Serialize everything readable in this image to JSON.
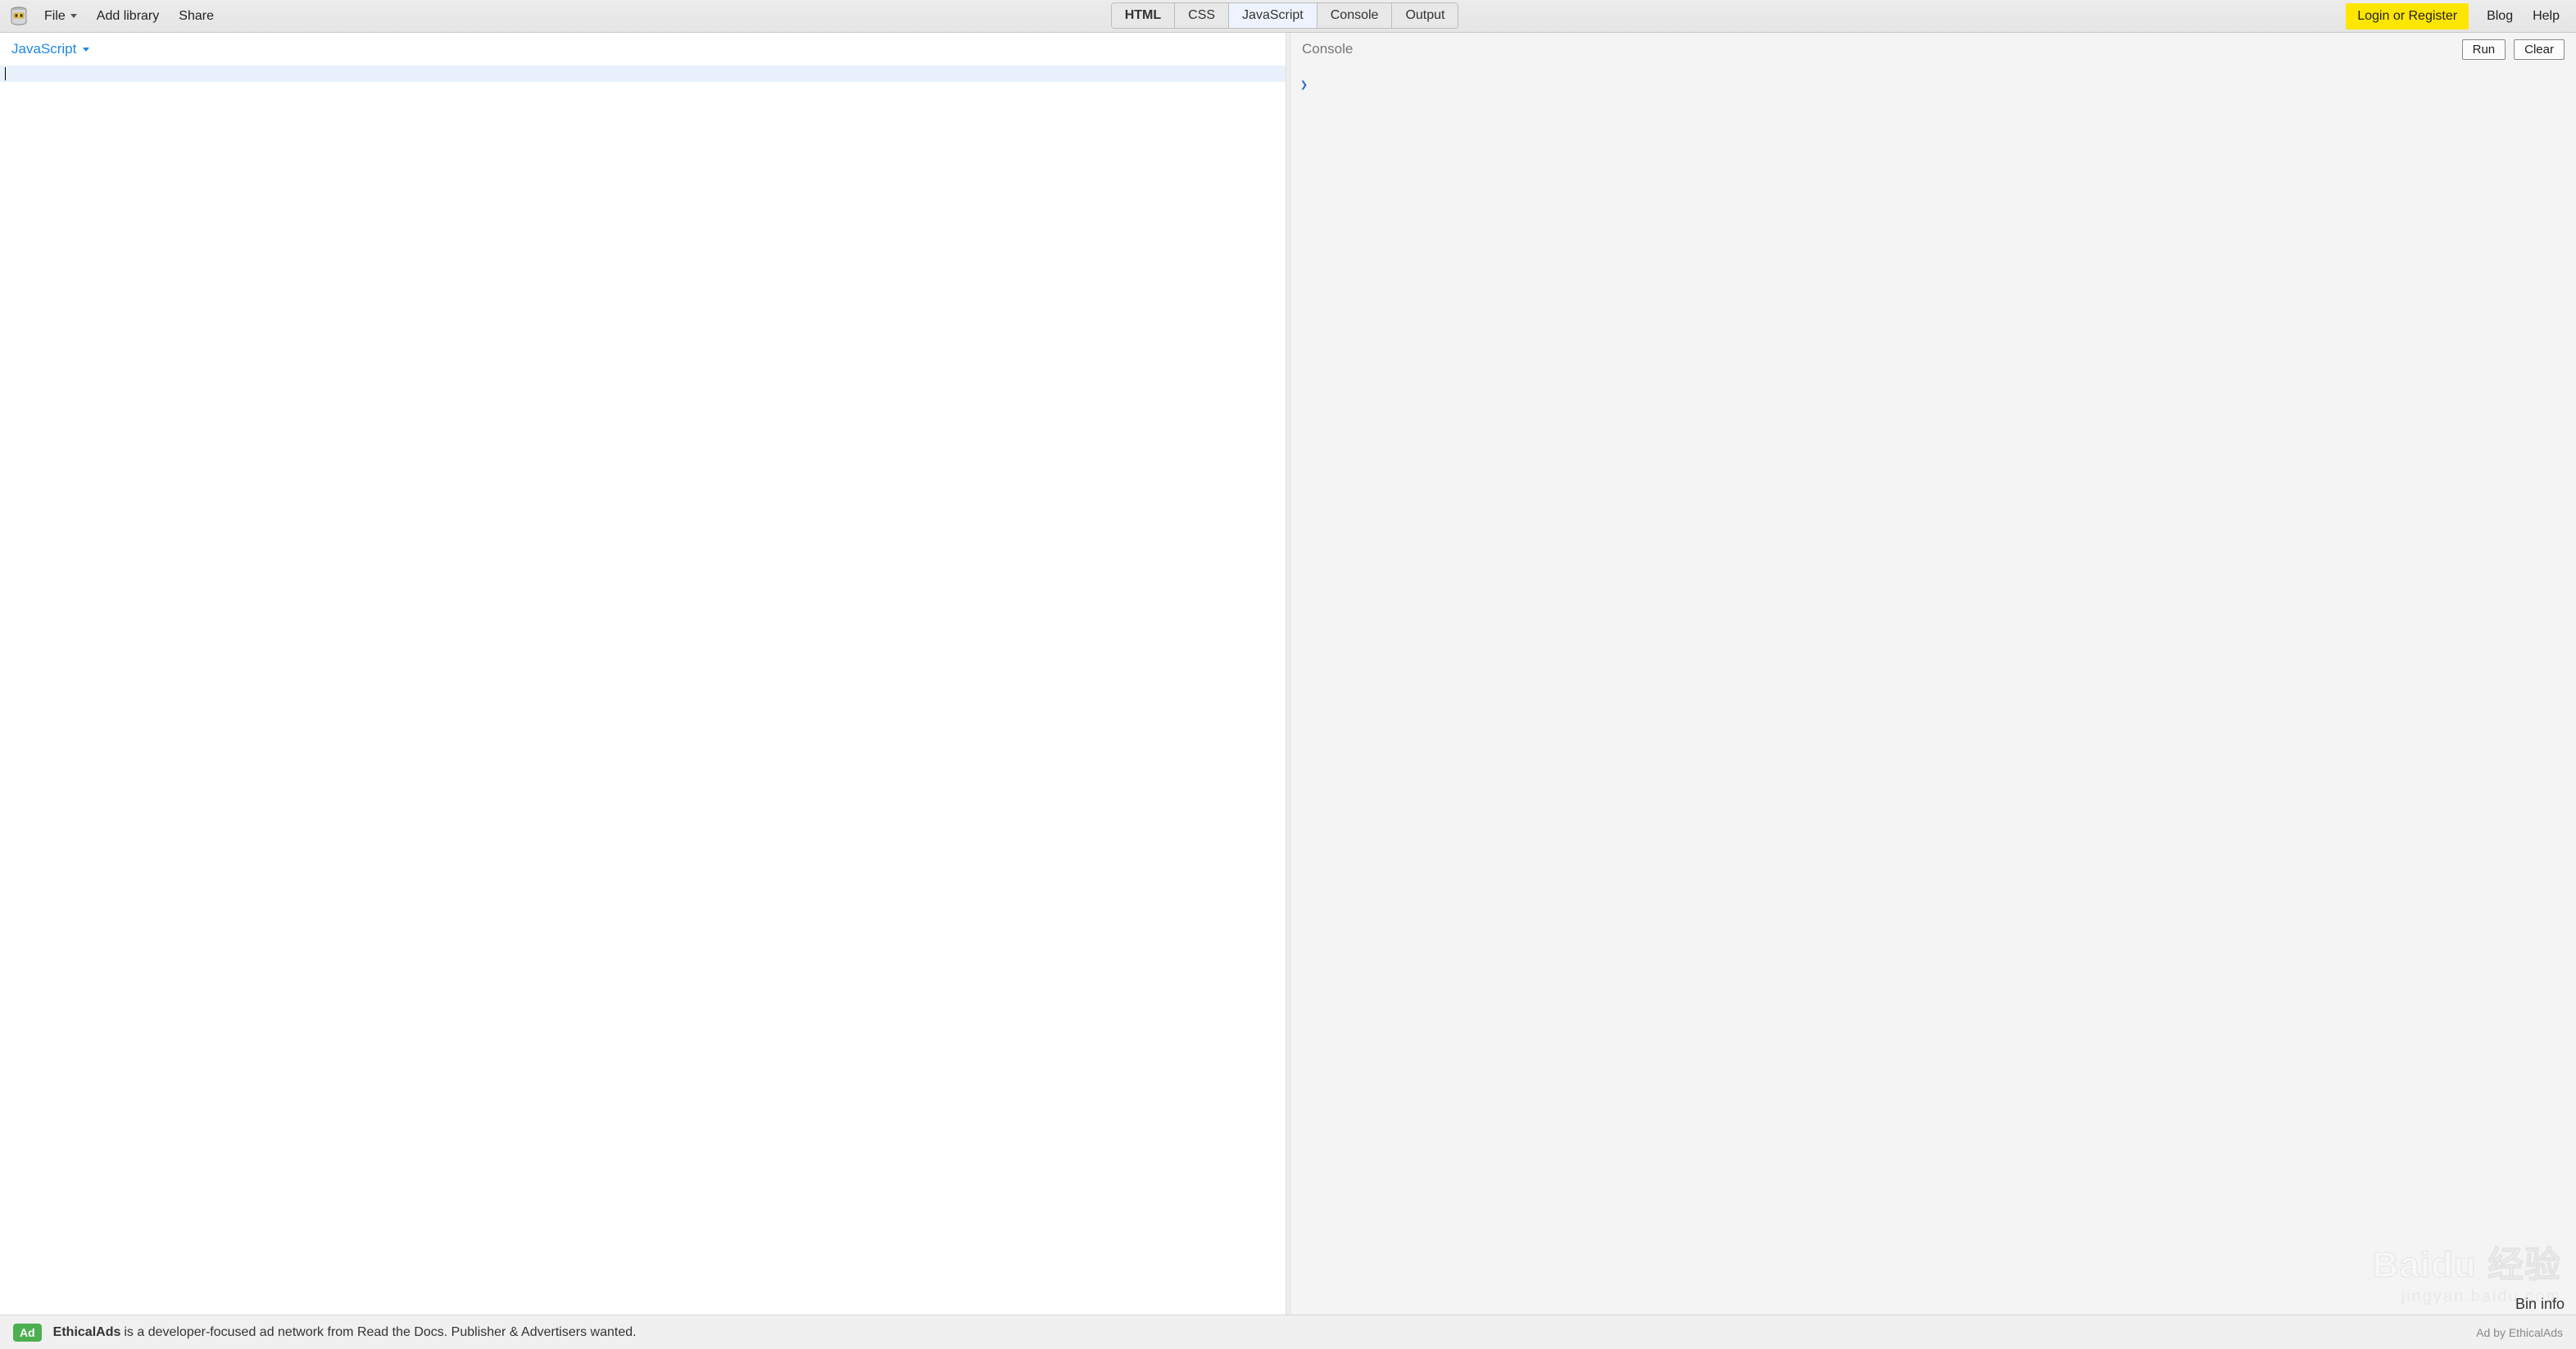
{
  "toolbar": {
    "file_label": "File",
    "addlib_label": "Add library",
    "share_label": "Share",
    "login_label": "Login or Register",
    "blog_label": "Blog",
    "help_label": "Help"
  },
  "panes": {
    "html": "HTML",
    "css": "CSS",
    "javascript": "JavaScript",
    "console": "Console",
    "output": "Output"
  },
  "editor": {
    "lang_label": "JavaScript"
  },
  "console": {
    "title": "Console",
    "run_label": "Run",
    "clear_label": "Clear",
    "prompt": "❯"
  },
  "bininfo_label": "Bin info",
  "ad": {
    "badge": "Ad",
    "brand": "EthicalAds",
    "text": "is a developer-focused ad network from Read the Docs. Publisher & Advertisers wanted.",
    "attrib": "Ad by EthicalAds"
  },
  "watermark": {
    "main": "Baidu 经验",
    "sub": "jingyan.baidu.com"
  }
}
